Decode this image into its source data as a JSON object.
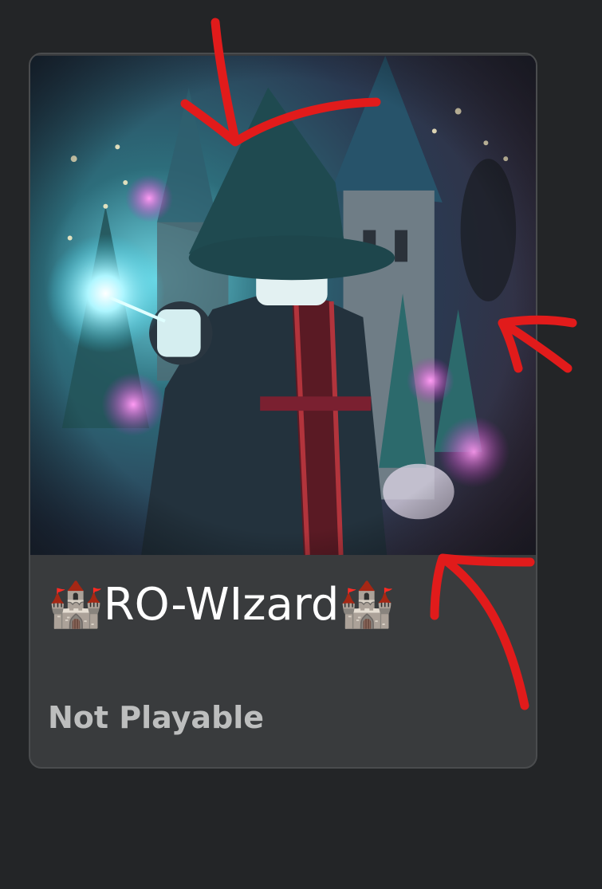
{
  "game_card": {
    "title": "🏰RO-WIzard🏰",
    "status": "Not Playable",
    "thumbnail_icon": "wizard-castle-thumbnail"
  },
  "colors": {
    "background": "#232527",
    "card": "#393b3d",
    "annotation": "#e11b1b"
  }
}
